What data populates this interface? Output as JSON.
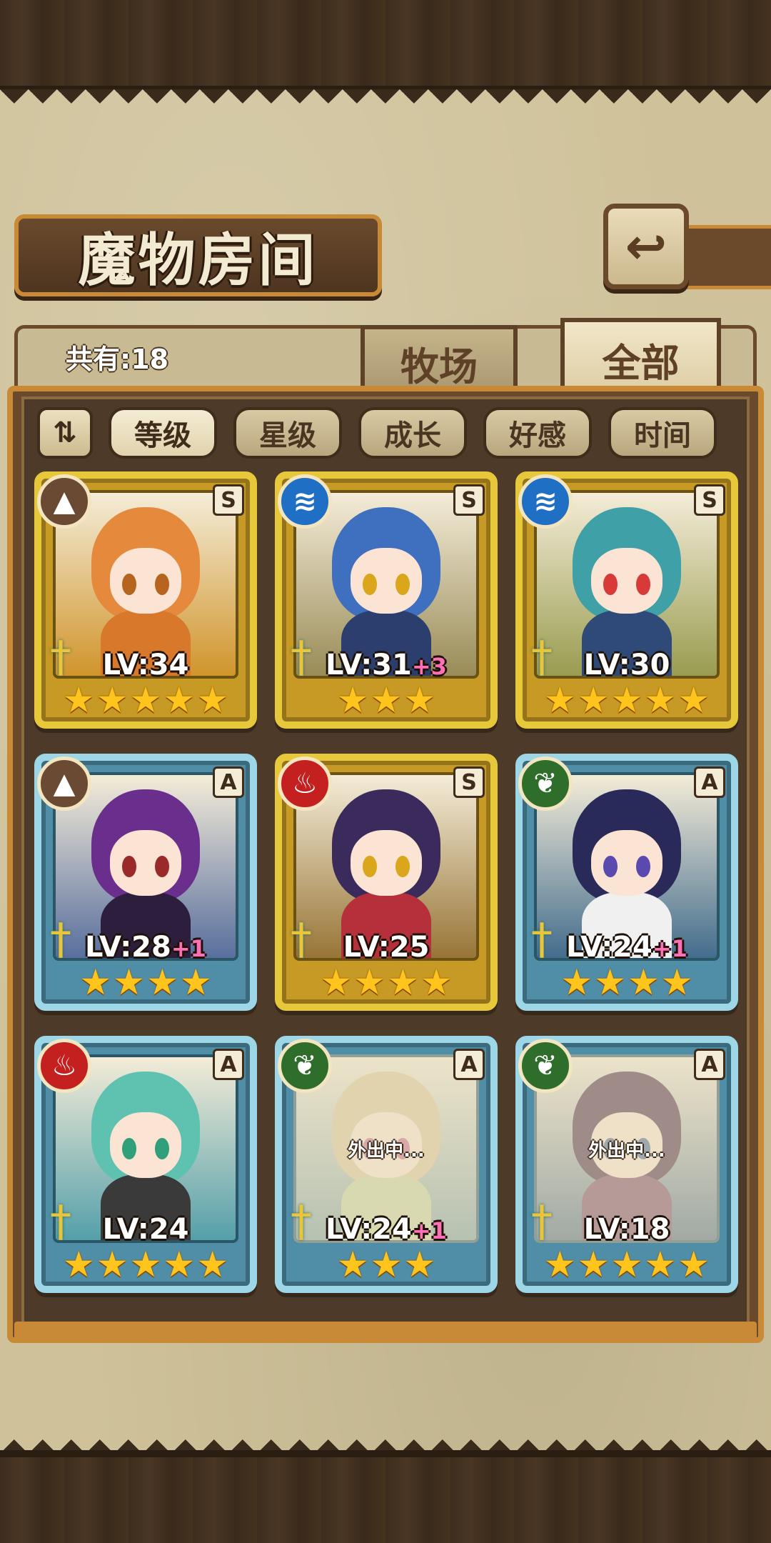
{
  "header": {
    "title": "魔物房间",
    "back_icon": "back-arrow-icon"
  },
  "summary": {
    "count_label": "共有:18"
  },
  "tabs": [
    {
      "label": "牧场",
      "active": false
    },
    {
      "label": "全部",
      "active": true
    }
  ],
  "sort": {
    "toggle_icon": "sort-order-icon",
    "toggle_glyph": "⇅",
    "options": [
      {
        "label": "等级",
        "active": true
      },
      {
        "label": "星级",
        "active": false
      },
      {
        "label": "成长",
        "active": false
      },
      {
        "label": "好感",
        "active": false
      },
      {
        "label": "时间",
        "active": false
      }
    ]
  },
  "monsters": [
    {
      "element": "earth",
      "rank": "S",
      "level": "LV:34",
      "bonus": "",
      "stars": 5,
      "frame": "gold",
      "away": false,
      "away_text": ""
    },
    {
      "element": "water",
      "rank": "S",
      "level": "LV:31",
      "bonus": "+3",
      "stars": 3,
      "frame": "gold",
      "away": false,
      "away_text": ""
    },
    {
      "element": "water",
      "rank": "S",
      "level": "LV:30",
      "bonus": "",
      "stars": 5,
      "frame": "gold",
      "away": false,
      "away_text": ""
    },
    {
      "element": "earth",
      "rank": "A",
      "level": "LV:28",
      "bonus": "+1",
      "stars": 4,
      "frame": "blue",
      "away": false,
      "away_text": ""
    },
    {
      "element": "fire",
      "rank": "S",
      "level": "LV:25",
      "bonus": "",
      "stars": 4,
      "frame": "gold",
      "away": false,
      "away_text": ""
    },
    {
      "element": "nature",
      "rank": "A",
      "level": "LV:24",
      "bonus": "+1",
      "stars": 4,
      "frame": "blue",
      "away": false,
      "away_text": ""
    },
    {
      "element": "fire",
      "rank": "A",
      "level": "LV:24",
      "bonus": "",
      "stars": 5,
      "frame": "blue",
      "away": false,
      "away_text": ""
    },
    {
      "element": "nature",
      "rank": "A",
      "level": "LV:24",
      "bonus": "+1",
      "stars": 3,
      "frame": "blue",
      "away": true,
      "away_text": "外出中..."
    },
    {
      "element": "nature",
      "rank": "A",
      "level": "LV:18",
      "bonus": "",
      "stars": 5,
      "frame": "blue",
      "away": true,
      "away_text": "外出中..."
    }
  ],
  "colors": {
    "gold_frame": "#e7c83a",
    "blue_frame": "#9dd6e6",
    "star": "#ffc51c",
    "bonus": "#ff6fb6",
    "earth": "#6b4a34",
    "water": "#1f6fc4",
    "fire": "#c4201f",
    "nature": "#2f6e2a"
  }
}
